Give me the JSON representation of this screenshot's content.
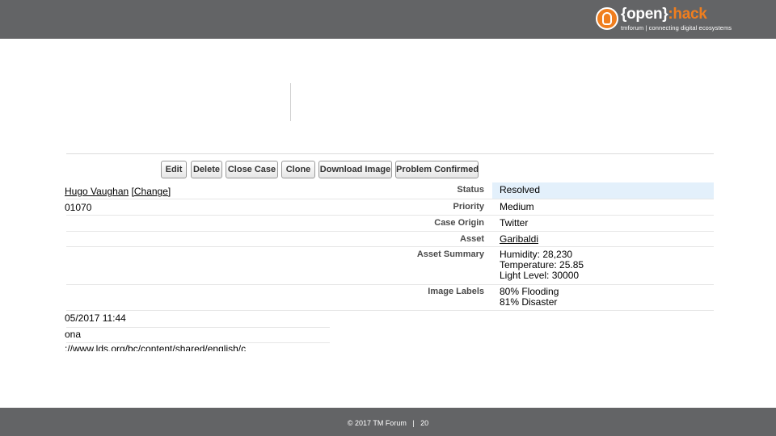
{
  "header": {
    "logo_open": "{open}",
    "logo_hack": ":hack",
    "logo_tagline": "tmforum | connecting digital ecosystems",
    "bar_color": "#636466",
    "accent_color": "#f07e1e"
  },
  "toolbar": {
    "edit": "Edit",
    "delete": "Delete",
    "close_case": "Close Case",
    "clone": "Clone",
    "download_image": "Download Image",
    "problem_confirmed": "Problem Confirmed"
  },
  "left_fields": {
    "owner_name": "Hugo Vaughan",
    "owner_change": "[Change]",
    "case_number": "01070",
    "date_time": "05/2017 11:44",
    "city": "ona",
    "url_partial": "://www.lds.org/bc/content/shared/english/c"
  },
  "details": {
    "status_label": "Status",
    "status_value": "Resolved",
    "priority_label": "Priority",
    "priority_value": "Medium",
    "origin_label": "Case Origin",
    "origin_value": "Twitter",
    "asset_label": "Asset",
    "asset_value": "Garibaldi",
    "summary_label": "Asset Summary",
    "summary_lines": [
      "Humidity: 28,230",
      "Temperature: 25.85",
      "Light Level: 30000"
    ],
    "image_labels_label": "Image Labels",
    "image_labels_lines": [
      "80% Flooding",
      "81% Disaster"
    ]
  },
  "footer": {
    "text": "© 2017 TM Forum   |   20"
  }
}
